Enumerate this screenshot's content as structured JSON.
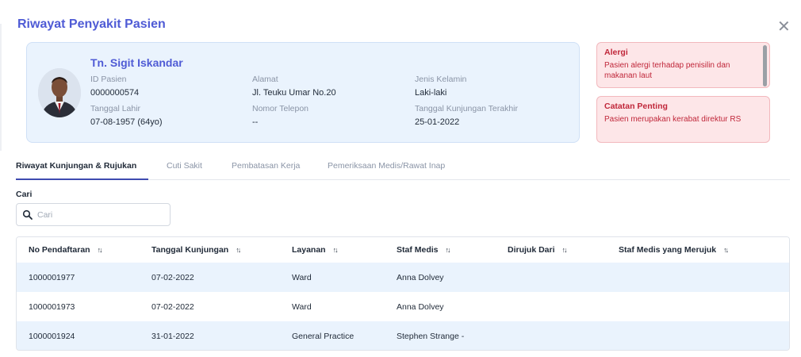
{
  "modal": {
    "title": "Riwayat Penyakit Pasien",
    "close_icon": "close-icon"
  },
  "patient": {
    "name": "Tn. Sigit Iskandar",
    "id_label": "ID Pasien",
    "id_value": "0000000574",
    "dob_label": "Tanggal Lahir",
    "dob_value": "07-08-1957 (64yo)",
    "address_label": "Alamat",
    "address_value": "Jl. Teuku Umar No.20",
    "phone_label": "Nomor Telepon",
    "phone_value": "--",
    "gender_label": "Jenis Kelamin",
    "gender_value": "Laki-laki",
    "last_visit_label": "Tanggal Kunjungan Terakhir",
    "last_visit_value": "25-01-2022"
  },
  "notes": {
    "alergi_title": "Alergi",
    "alergi_text": "Pasien alergi terhadap penisilin dan makanan laut",
    "catatan_title": "Catatan Penting",
    "catatan_text": "Pasien merupakan kerabat direktur RS"
  },
  "tabs": [
    {
      "label": "Riwayat Kunjungan & Rujukan",
      "active": true
    },
    {
      "label": "Cuti Sakit",
      "active": false
    },
    {
      "label": "Pembatasan Kerja",
      "active": false
    },
    {
      "label": "Pemeriksaan Medis/Rawat Inap",
      "active": false
    }
  ],
  "search": {
    "label": "Cari",
    "placeholder": "Cari",
    "value": ""
  },
  "table": {
    "columns": [
      "No Pendaftaran",
      "Tanggal Kunjungan",
      "Layanan",
      "Staf Medis",
      "Dirujuk Dari",
      "Staf Medis yang Merujuk"
    ],
    "rows": [
      [
        "1000001977",
        "07-02-2022",
        "Ward",
        "Anna Dolvey",
        "",
        ""
      ],
      [
        "1000001973",
        "07-02-2022",
        "Ward",
        "Anna Dolvey",
        "",
        ""
      ],
      [
        "1000001924",
        "31-01-2022",
        "General Practice",
        "Stephen Strange -",
        "",
        ""
      ]
    ]
  },
  "colors": {
    "accent": "#4f5bd5",
    "card_bg": "#eaf3fd",
    "alert_bg": "#fde6e8",
    "alert_text": "#c0273a"
  }
}
